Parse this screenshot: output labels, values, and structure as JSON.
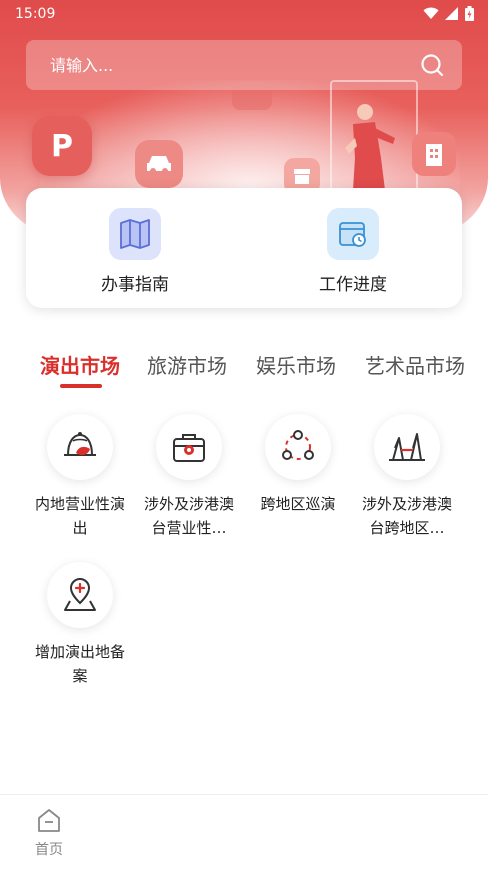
{
  "status_bar": {
    "time": "15:09"
  },
  "search": {
    "placeholder": "请输入..."
  },
  "quick_actions": [
    {
      "label": "办事指南",
      "icon": "map-guide-icon"
    },
    {
      "label": "工作进度",
      "icon": "calendar-clock-icon"
    }
  ],
  "tabs": [
    {
      "label": "演出市场",
      "active": true
    },
    {
      "label": "旅游市场",
      "active": false
    },
    {
      "label": "娱乐市场",
      "active": false
    },
    {
      "label": "艺术品市场",
      "active": false
    }
  ],
  "services": [
    {
      "label": "内地营业性演出",
      "icon": "theater-hat-icon"
    },
    {
      "label": "涉外及涉港澳台营业性…",
      "icon": "briefcase-icon"
    },
    {
      "label": "跨地区巡演",
      "icon": "circuit-tour-icon"
    },
    {
      "label": "涉外及涉港澳台跨地区…",
      "icon": "landmark-icon"
    },
    {
      "label": "增加演出地备案",
      "icon": "location-add-icon"
    }
  ],
  "bottom_nav": {
    "home_label": "首页"
  },
  "colors": {
    "accent": "#d9302c",
    "hero": "#e04b4b"
  }
}
